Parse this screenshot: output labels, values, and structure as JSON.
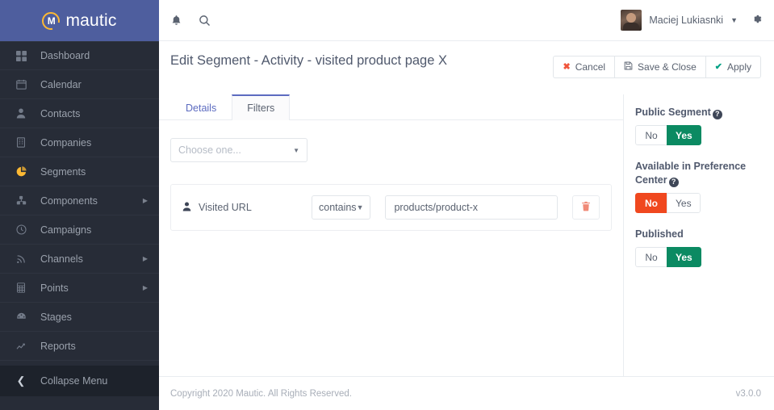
{
  "brand": {
    "name": "mautic",
    "mark_letter": "M"
  },
  "sidebar": {
    "items": [
      {
        "label": "Dashboard",
        "icon": "grid-icon",
        "has_submenu": false,
        "active": false
      },
      {
        "label": "Calendar",
        "icon": "calendar-icon",
        "has_submenu": false,
        "active": false
      },
      {
        "label": "Contacts",
        "icon": "user-icon",
        "has_submenu": false,
        "active": false
      },
      {
        "label": "Companies",
        "icon": "building-icon",
        "has_submenu": false,
        "active": false
      },
      {
        "label": "Segments",
        "icon": "pie-chart-icon",
        "has_submenu": false,
        "active": true
      },
      {
        "label": "Components",
        "icon": "puzzle-icon",
        "has_submenu": true,
        "active": false
      },
      {
        "label": "Campaigns",
        "icon": "clock-icon",
        "has_submenu": false,
        "active": false
      },
      {
        "label": "Channels",
        "icon": "rss-icon",
        "has_submenu": true,
        "active": false
      },
      {
        "label": "Points",
        "icon": "calculator-icon",
        "has_submenu": true,
        "active": false
      },
      {
        "label": "Stages",
        "icon": "gauge-icon",
        "has_submenu": false,
        "active": false
      },
      {
        "label": "Reports",
        "icon": "line-chart-icon",
        "has_submenu": false,
        "active": false
      }
    ],
    "collapse_label": "Collapse Menu"
  },
  "topbar": {
    "notifications_icon": "bell-icon",
    "search_icon": "search-icon",
    "user_name": "Maciej Lukiasnki",
    "settings_icon": "gear-icon"
  },
  "page": {
    "title": "Edit Segment - Activity - visited product page X",
    "actions": [
      {
        "label": "Cancel",
        "glyph": "✖",
        "glyph_class": "red"
      },
      {
        "label": "Save & Close",
        "glyph": "ὋE",
        "glyph_class": "grey"
      },
      {
        "label": "Apply",
        "glyph": "✔",
        "glyph_class": "green"
      }
    ]
  },
  "tabs": [
    {
      "label": "Details",
      "active": false
    },
    {
      "label": "Filters",
      "active": true
    }
  ],
  "filters": {
    "choose_placeholder": "Choose one...",
    "rows": [
      {
        "field_label": "Visited URL",
        "field_icon": "user-icon",
        "operator": "contains",
        "value": "products/product-x",
        "delete_icon": "trash-icon"
      }
    ]
  },
  "rail": {
    "groups": [
      {
        "label": "Public Segment",
        "has_help": true,
        "options": [
          {
            "label": "No",
            "state": "off"
          },
          {
            "label": "Yes",
            "state": "on-green"
          }
        ]
      },
      {
        "label": "Available in Preference Center",
        "has_help": true,
        "options": [
          {
            "label": "No",
            "state": "on-red"
          },
          {
            "label": "Yes",
            "state": "off"
          }
        ]
      },
      {
        "label": "Published",
        "has_help": false,
        "options": [
          {
            "label": "No",
            "state": "off"
          },
          {
            "label": "Yes",
            "state": "on-green"
          }
        ]
      }
    ]
  },
  "footer": {
    "copyright": "Copyright 2020 Mautic. All Rights Reserved.",
    "version": "v3.0.0"
  },
  "colors": {
    "brand_bar": "#4e5e9e",
    "sidebar_bg": "#272c37",
    "accent_yellow": "#fdb933",
    "toggle_green": "#0b8a62",
    "toggle_red": "#f0481f",
    "tab_active_border": "#5c6bc0",
    "danger": "#f0553b",
    "success": "#00a185"
  }
}
